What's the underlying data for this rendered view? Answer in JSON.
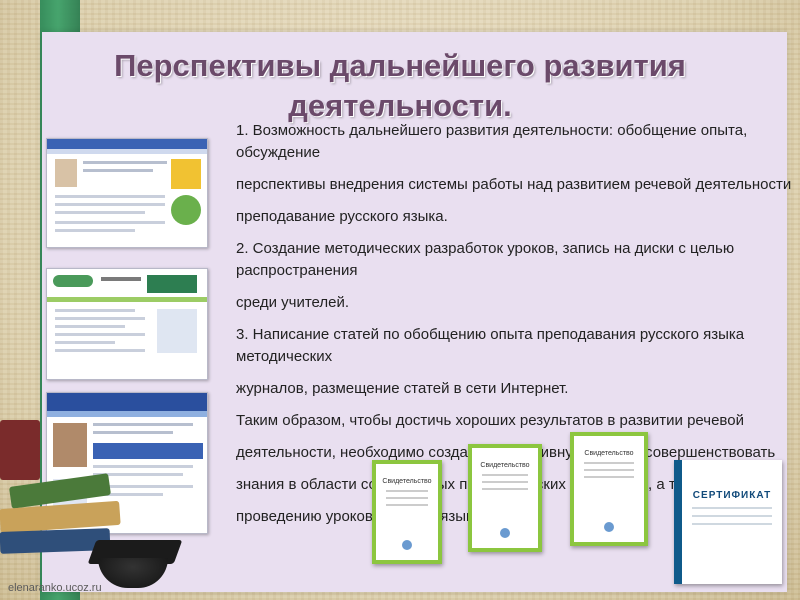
{
  "slide": {
    "title_line1": "Перспективы дальнейшего развития",
    "title_line2": "деятельности.",
    "paragraphs": [
      "1. Возможность дальнейшего развития деятельности: обобщение опыта,",
      "обсуждение",
      "перспективы внедрения системы работы над развитием речевой деятельности",
      "преподавание русского языка.",
      "2. Создание методических разработок уроков, запись на диски с целью",
      "распространения",
      " среди учителей.",
      "3. Написание  статей по обобщению опыта преподавания русского языка",
      "методических",
      " журналов, размещение статей в сети Интернет.",
      "      Таким образом, чтобы достичь хороших результатов в развитии речевой",
      "деятельности, необходимо создавать креативную среду и совершенствовать",
      "знания в области современных педагогических технологий, а также",
      "проведению уроков русского языка."
    ],
    "certificate_label": "Свидетельство",
    "certificate_label_2": "СЕРТИФИКАТ",
    "footer": "elenaranko.ucoz.ru"
  }
}
